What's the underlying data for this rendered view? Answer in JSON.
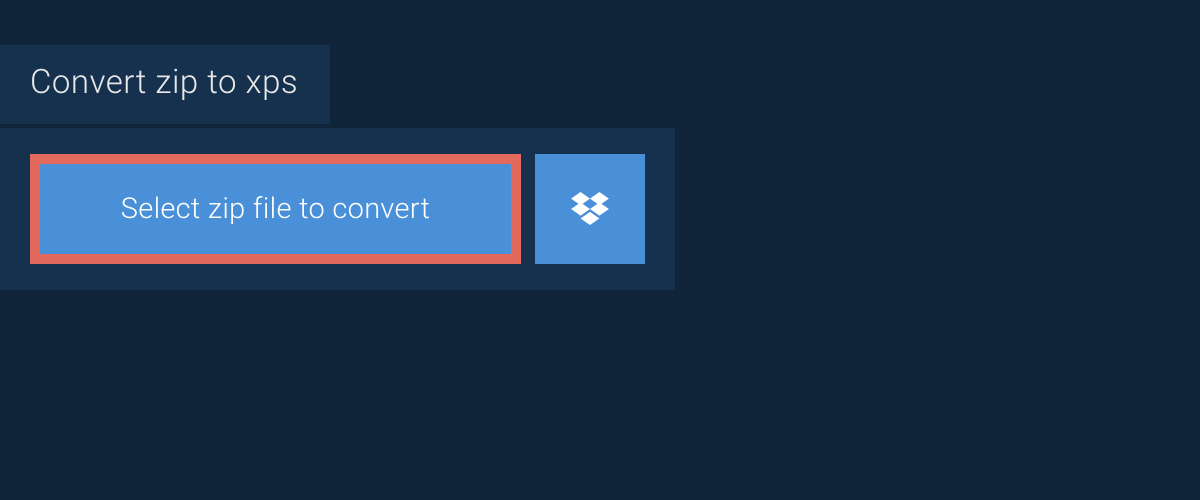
{
  "tab": {
    "label": "Convert zip to xps"
  },
  "upload": {
    "select_button_label": "Select zip file to convert"
  },
  "colors": {
    "page_bg": "#0f2438",
    "panel_bg": "#15314d",
    "button_bg": "#4a90d9",
    "highlight_border": "#e2695b"
  }
}
